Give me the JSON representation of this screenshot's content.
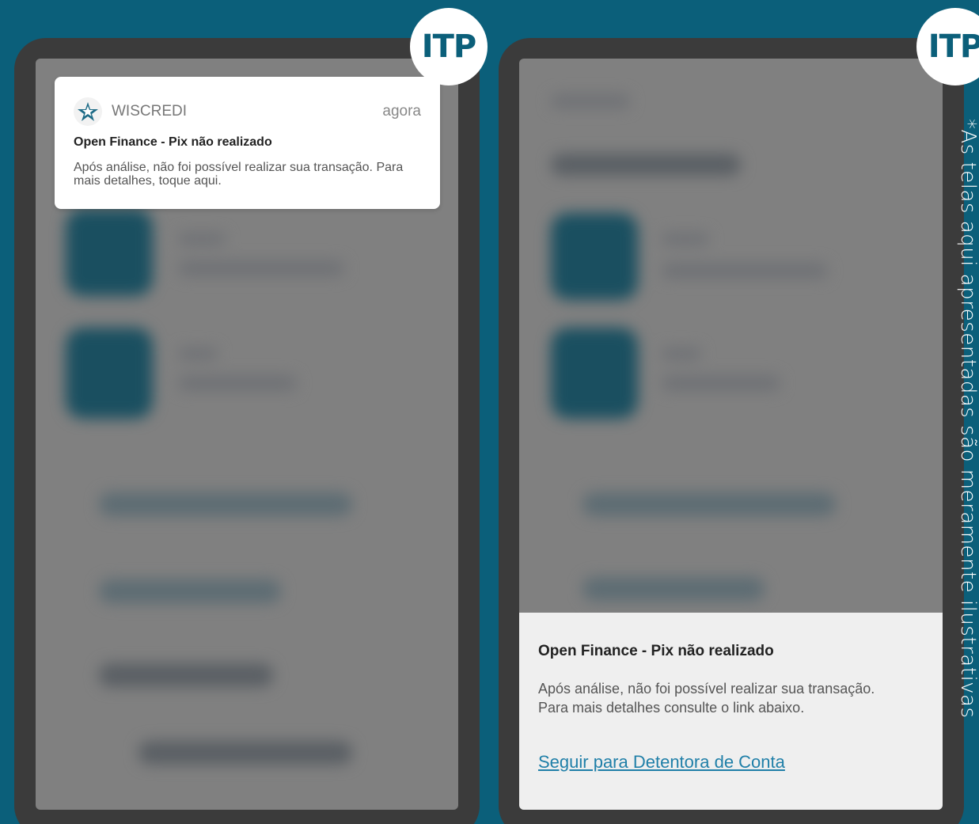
{
  "badge": {
    "left_label": "ITP",
    "right_label": "ITP"
  },
  "notification": {
    "app_name": "WISCREDI",
    "time": "agora",
    "title": "Open Finance - Pix não realizado",
    "body": "Após análise, não foi possível realizar sua transação. Para mais detalhes, toque aqui.",
    "icon": "wiscredi-star-logo"
  },
  "sheet": {
    "title": "Open Finance - Pix não realizado",
    "body": "Após análise, não foi possível realizar sua transação. Para mais detalhes consulte o link abaixo.",
    "link_label": "Seguir para Detentora de Conta"
  },
  "disclaimer": "*As telas aqui apresentadas são meramente ilustrativas",
  "colors": {
    "background": "#0b5f7a",
    "phone_frame": "#3b3b3b",
    "link": "#1f7fa8"
  }
}
